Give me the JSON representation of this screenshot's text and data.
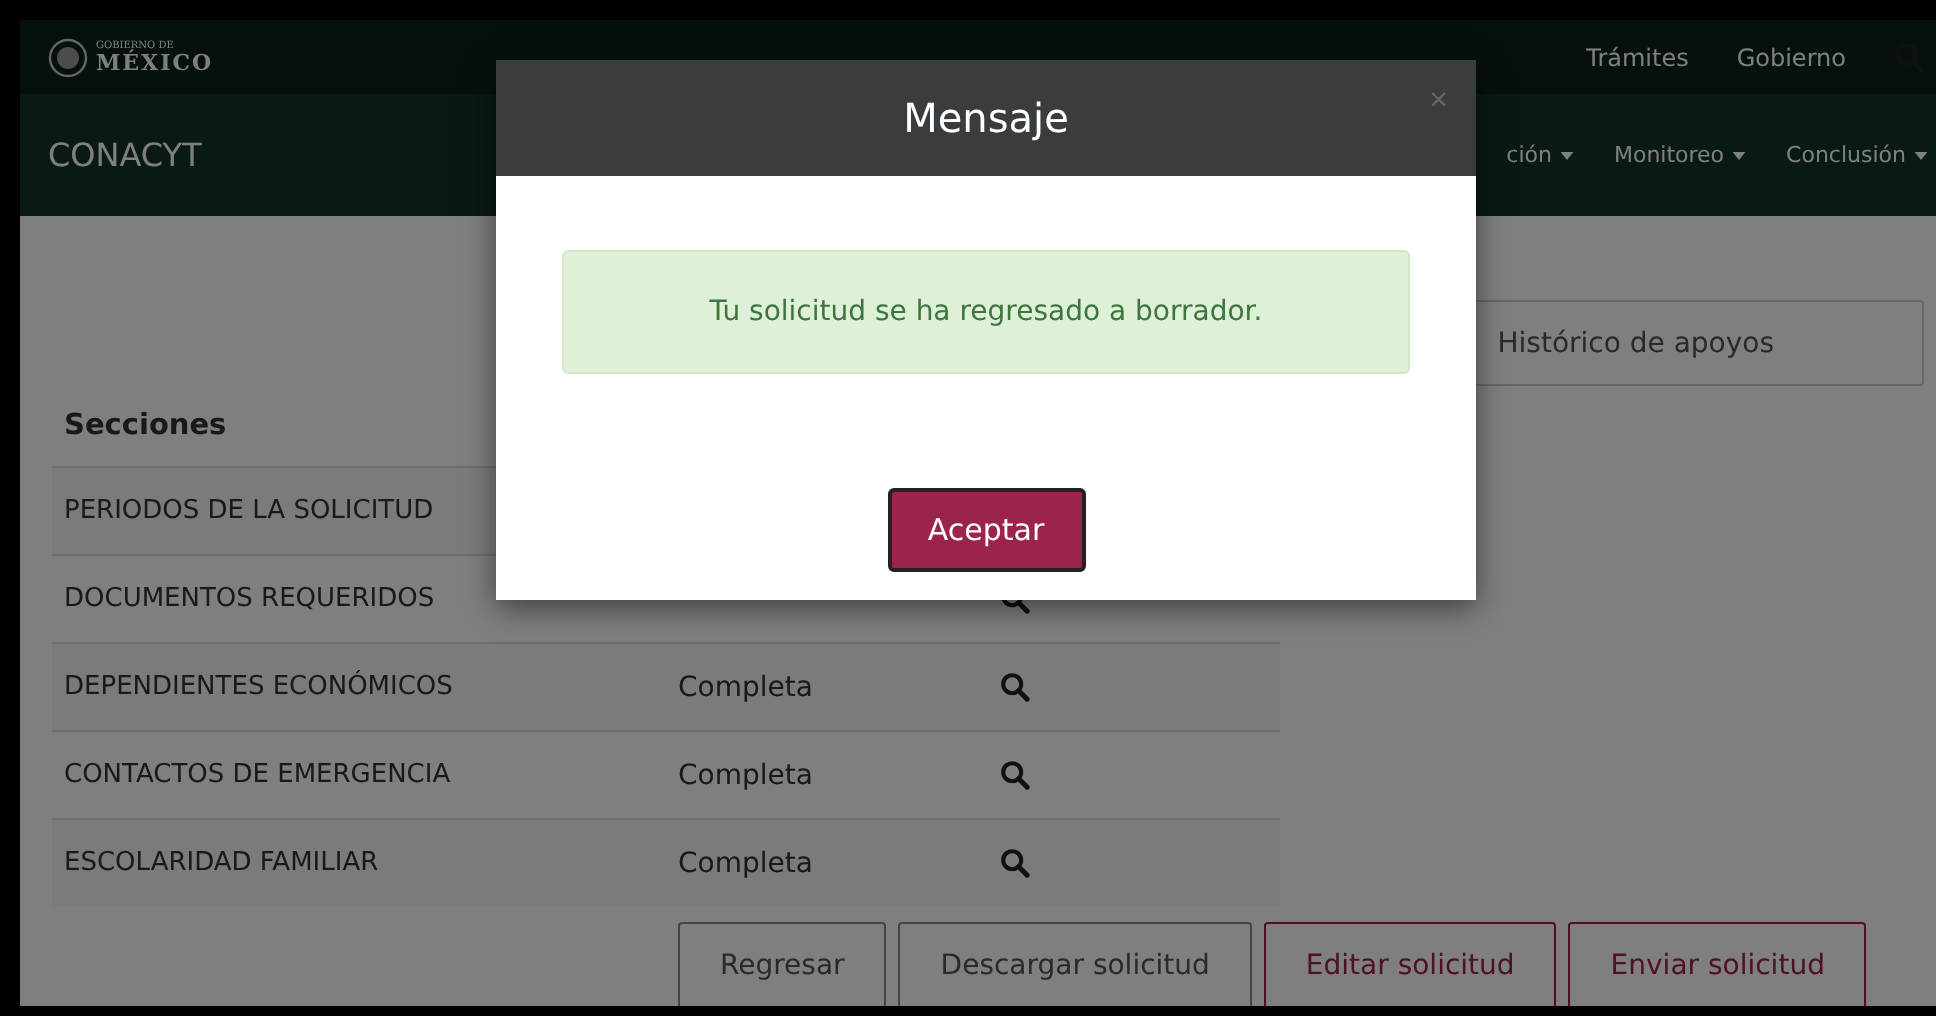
{
  "header": {
    "logo_small": "GOBIERNO DE",
    "logo_big": "MÉXICO",
    "links": [
      "Trámites",
      "Gobierno"
    ]
  },
  "navbar": {
    "brand": "CONACYT",
    "menus": [
      "ción",
      "Monitoreo",
      "Conclusión"
    ]
  },
  "history_button": "Histórico de apoyos",
  "sections": {
    "title": "Secciones",
    "rows": [
      {
        "name": "PERIODOS DE LA SOLICITUD",
        "viewable": false
      },
      {
        "name": "DOCUMENTOS REQUERIDOS",
        "viewable": true
      },
      {
        "name": "DEPENDIENTES ECONÓMICOS",
        "status": "Completa",
        "viewable": true
      },
      {
        "name": "CONTACTOS DE EMERGENCIA",
        "status": "Completa",
        "viewable": true
      },
      {
        "name": "ESCOLARIDAD FAMILIAR",
        "status": "Completa",
        "viewable": true
      }
    ]
  },
  "actions": [
    {
      "label": "Regresar",
      "kind": "default"
    },
    {
      "label": "Descargar solicitud",
      "kind": "default"
    },
    {
      "label": "Editar solicitud",
      "kind": "primary"
    },
    {
      "label": "Enviar solicitud",
      "kind": "primary"
    }
  ],
  "modal": {
    "title": "Mensaje",
    "close": "×",
    "message": "Tu solicitud se ha regresado a borrador.",
    "button": "Aceptar"
  }
}
